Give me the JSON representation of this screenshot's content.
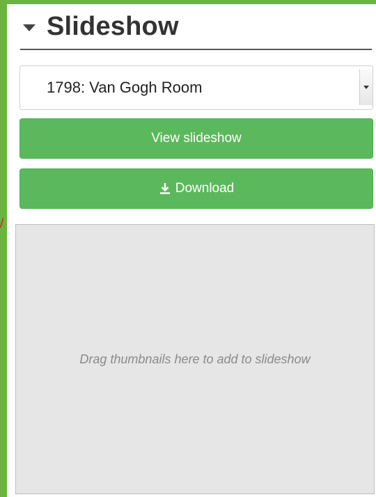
{
  "panel": {
    "title": "Slideshow"
  },
  "select": {
    "selected": "1798: Van Gogh Room"
  },
  "buttons": {
    "view_label": "View slideshow",
    "download_label": "Download"
  },
  "dropzone": {
    "hint": "Drag thumbnails here to add to slideshow"
  },
  "icons": {
    "collapse": "caret-down-icon",
    "download": "download-icon",
    "select_arrow": "chevron-down-icon"
  },
  "colors": {
    "accent_green": "#5cb85c",
    "frame_green": "#6cb33f"
  }
}
